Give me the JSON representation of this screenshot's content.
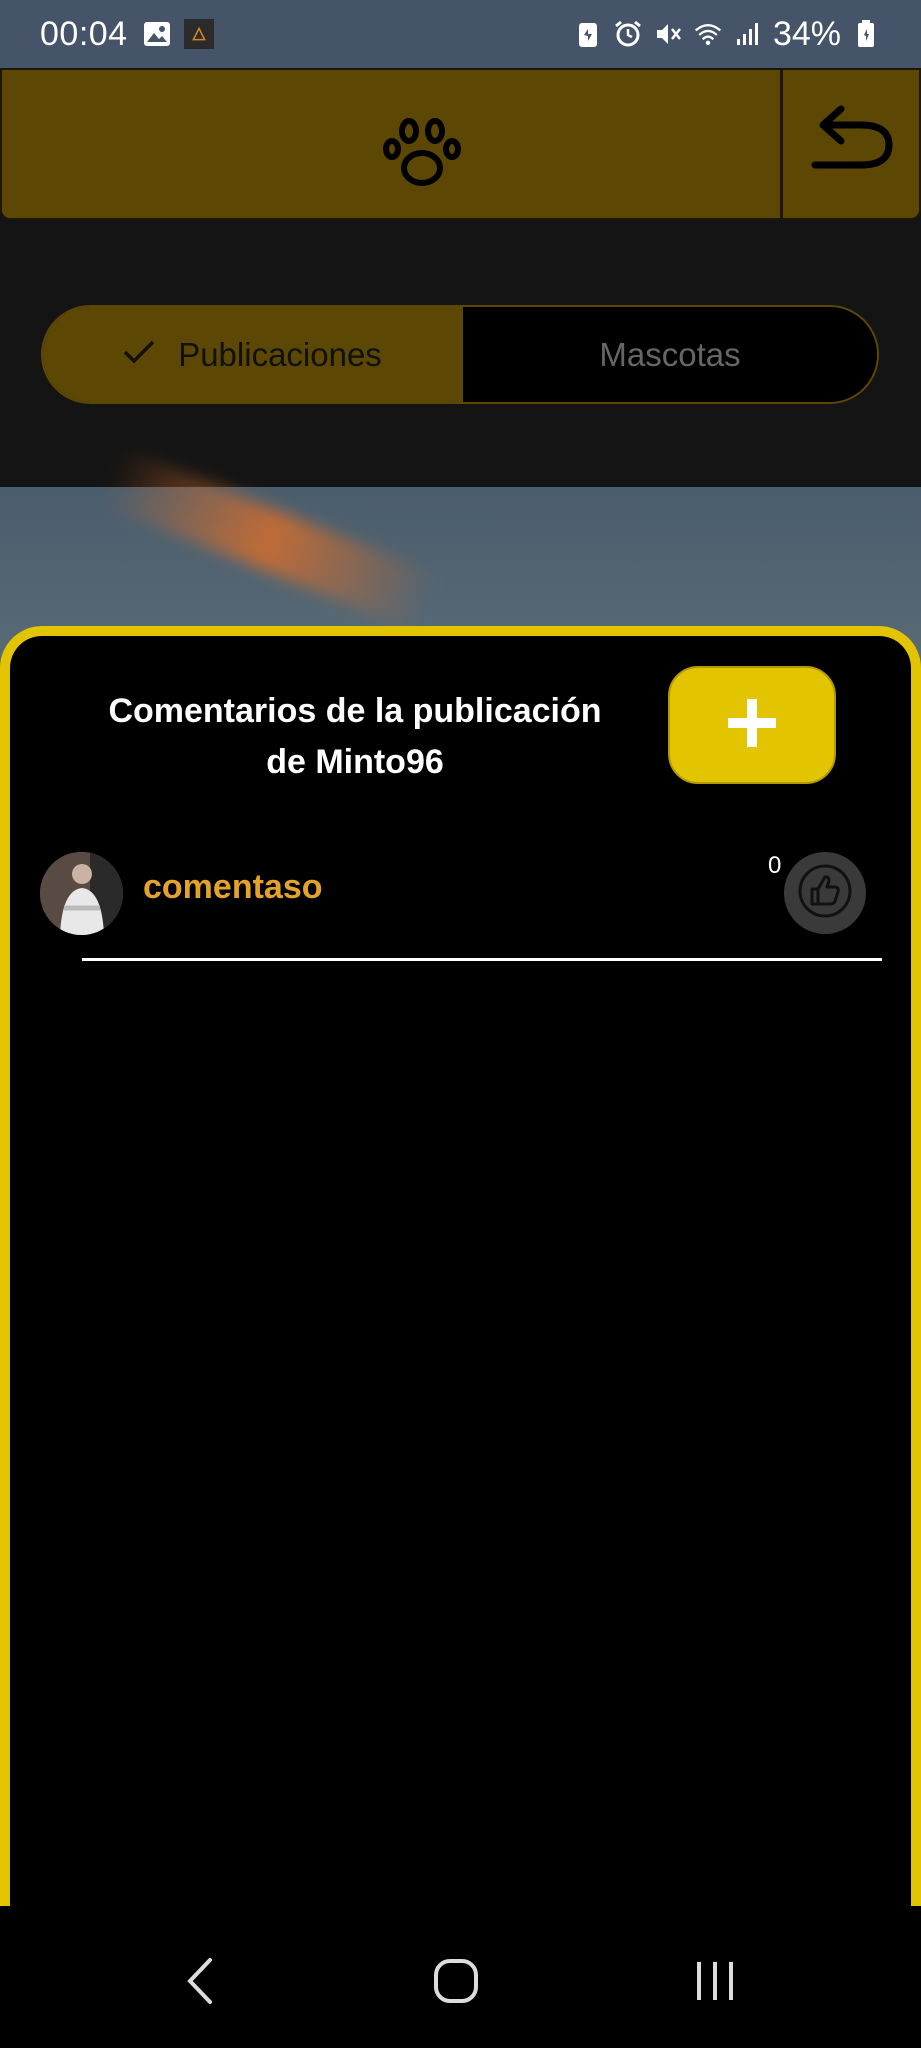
{
  "status_bar": {
    "time": "00:04",
    "battery": "34%",
    "left_icons": [
      "image-icon",
      "app-notification-icon"
    ],
    "right_icons": [
      "battery-saver-icon",
      "alarm-icon",
      "mute-icon",
      "wifi-icon",
      "signal-icon",
      "battery-icon"
    ]
  },
  "header": {
    "logo_icon": "paw-icon",
    "back_icon": "undo-arrow-icon"
  },
  "tabs": [
    {
      "label": "Publicaciones",
      "selected": true
    },
    {
      "label": "Mascotas",
      "selected": false
    }
  ],
  "comments_modal": {
    "title_line1": "Comentarios de la publicación",
    "title_line2": "de Minto96",
    "add_icon": "plus-icon",
    "comments": [
      {
        "text": "comentaso",
        "likes": "0",
        "like_icon": "thumbs-up-icon"
      }
    ]
  },
  "nav_bar": {
    "items": [
      "back-icon",
      "home-icon",
      "recent-apps-icon"
    ]
  },
  "colors": {
    "header": "#5c4804",
    "accent_yellow": "#e3c400",
    "comment_text": "#e3a32a",
    "status_bar": "#465469"
  }
}
